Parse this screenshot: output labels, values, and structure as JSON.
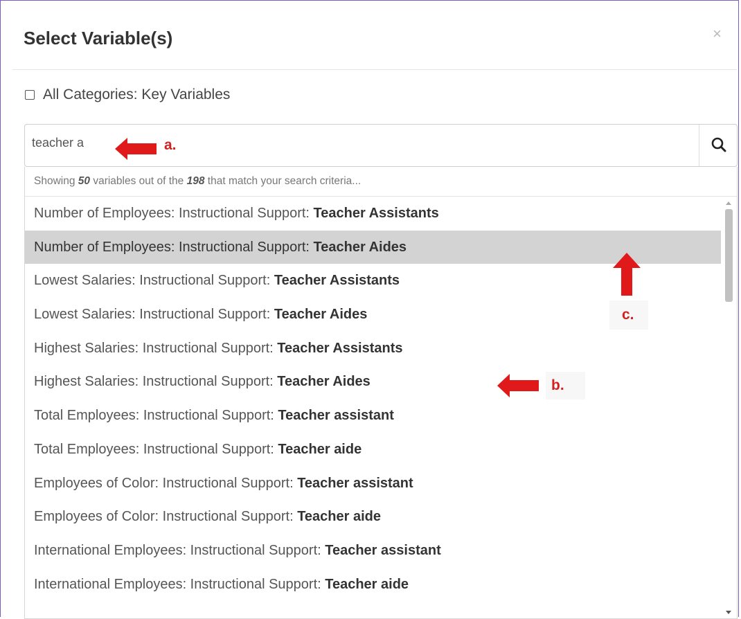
{
  "modal": {
    "title": "Select Variable(s)",
    "close_symbol": "×"
  },
  "key_variables": {
    "label": "All Categories: Key Variables",
    "checked": false
  },
  "search": {
    "value": "teacher a",
    "icon": "search-icon"
  },
  "results_info": {
    "prefix": "Showing ",
    "shown": "50",
    "middle": " variables out of the ",
    "total": "198",
    "suffix": " that match your search criteria..."
  },
  "results": [
    {
      "pre": "Number of Employees: Instructional Support: ",
      "bold": "Teacher Assistants",
      "highlighted": false
    },
    {
      "pre": "Number of Employees: Instructional Support: ",
      "bold": "Teacher Aides",
      "highlighted": true
    },
    {
      "pre": "Lowest Salaries: Instructional Support: ",
      "bold": "Teacher Assistants",
      "highlighted": false
    },
    {
      "pre": "Lowest Salaries: Instructional Support: ",
      "bold": "Teacher Aides",
      "highlighted": false
    },
    {
      "pre": "Highest Salaries: Instructional Support: ",
      "bold": "Teacher Assistants",
      "highlighted": false
    },
    {
      "pre": "Highest Salaries: Instructional Support: ",
      "bold": "Teacher Aides",
      "highlighted": false
    },
    {
      "pre": "Total Employees: Instructional Support: ",
      "bold": "Teacher assistant",
      "highlighted": false
    },
    {
      "pre": "Total Employees: Instructional Support: ",
      "bold": "Teacher aide",
      "highlighted": false
    },
    {
      "pre": "Employees of Color: Instructional Support: ",
      "bold": "Teacher assistant",
      "highlighted": false
    },
    {
      "pre": "Employees of Color: Instructional Support: ",
      "bold": "Teacher aide",
      "highlighted": false
    },
    {
      "pre": "International Employees: Instructional Support: ",
      "bold": "Teacher assistant",
      "highlighted": false
    },
    {
      "pre": "International Employees: Instructional Support: ",
      "bold": "Teacher aide",
      "highlighted": false
    }
  ],
  "annotations": {
    "a": "a.",
    "b": "b.",
    "c": "c."
  },
  "colors": {
    "annotation": "#d42020",
    "frame": "#7b5cc4",
    "highlight_row": "#d3d3d3"
  }
}
